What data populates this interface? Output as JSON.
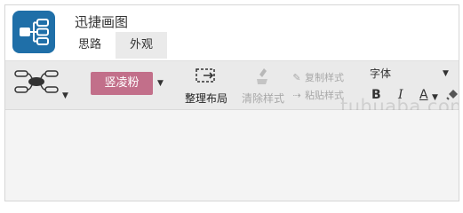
{
  "app": {
    "title": "迅捷画图"
  },
  "tabs": [
    {
      "label": "思路"
    },
    {
      "label": "外观"
    }
  ],
  "toolbar": {
    "theme_label": "竖凌粉",
    "arrange_label": "整理布局",
    "clear_style_label": "清除样式",
    "copy_style_label": "复制样式",
    "paste_style_label": "粘贴样式",
    "font_label": "字体",
    "bold_label": "B",
    "italic_label": "I",
    "font_color_label": "A"
  },
  "watermark": "tuhuaba.com",
  "colors": {
    "logo": "#1f6fa8",
    "theme_button": "#c26f8a",
    "toolbar_bg": "#eaeaea"
  }
}
